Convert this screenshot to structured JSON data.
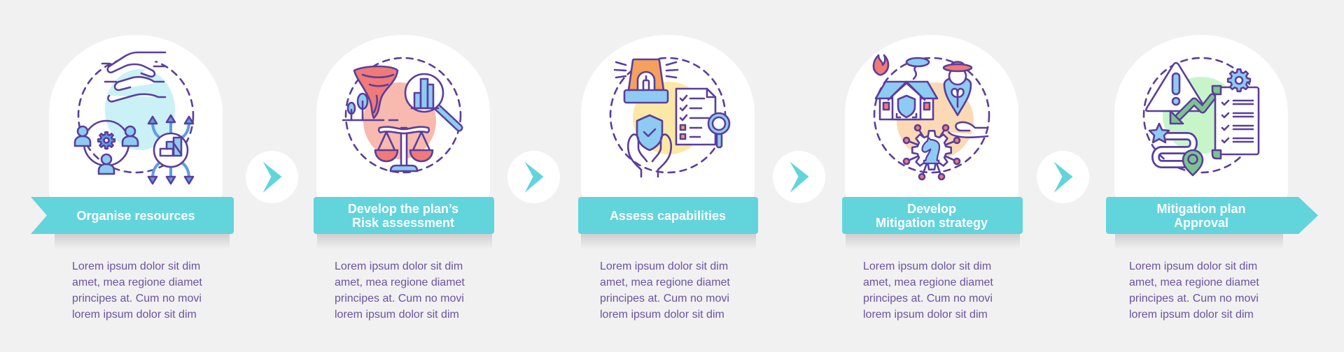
{
  "colors": {
    "background": "#f1f1f1",
    "accent": "#62d4dc",
    "text": "#6b52a3",
    "icon_stroke": "#5a3e9b"
  },
  "steps": [
    {
      "title": "Organise resources",
      "description": "Lorem ipsum dolor sit dim\namet, mea regione diamet\nprincipes at. Cum no movi\nlorem ipsum dolor sit dim",
      "icon": "organise-resources-icon",
      "blob_color": "#c9f1f6"
    },
    {
      "title": "Develop the plan’s\nRisk assessment",
      "description": "Lorem ipsum dolor sit dim\namet, mea regione diamet\nprincipes at. Cum no movi\nlorem ipsum dolor sit dim",
      "icon": "risk-assessment-icon",
      "blob_color": "#f8b9ae"
    },
    {
      "title": "Assess capabilities",
      "description": "Lorem ipsum dolor sit dim\namet, mea regione diamet\nprincipes at. Cum no movi\nlorem ipsum dolor sit dim",
      "icon": "assess-capabilities-icon",
      "blob_color": "#fbe8a6"
    },
    {
      "title": "Develop\nMitigation strategy",
      "description": "Lorem ipsum dolor sit dim\namet, mea regione diamet\nprincipes at. Cum no movi\nlorem ipsum dolor sit dim",
      "icon": "mitigation-strategy-icon",
      "blob_color": "#fbd9b4"
    },
    {
      "title": "Mitigation plan\nApproval",
      "description": "Lorem ipsum dolor sit dim\namet, mea regione diamet\nprincipes at. Cum no movi\nlorem ipsum dolor sit dim",
      "icon": "plan-approval-icon",
      "blob_color": "#c7f5c9"
    }
  ],
  "connectors": [
    {
      "icon": "chevron-right-icon"
    },
    {
      "icon": "chevron-right-icon"
    },
    {
      "icon": "chevron-right-icon"
    },
    {
      "icon": "chevron-right-icon"
    }
  ]
}
